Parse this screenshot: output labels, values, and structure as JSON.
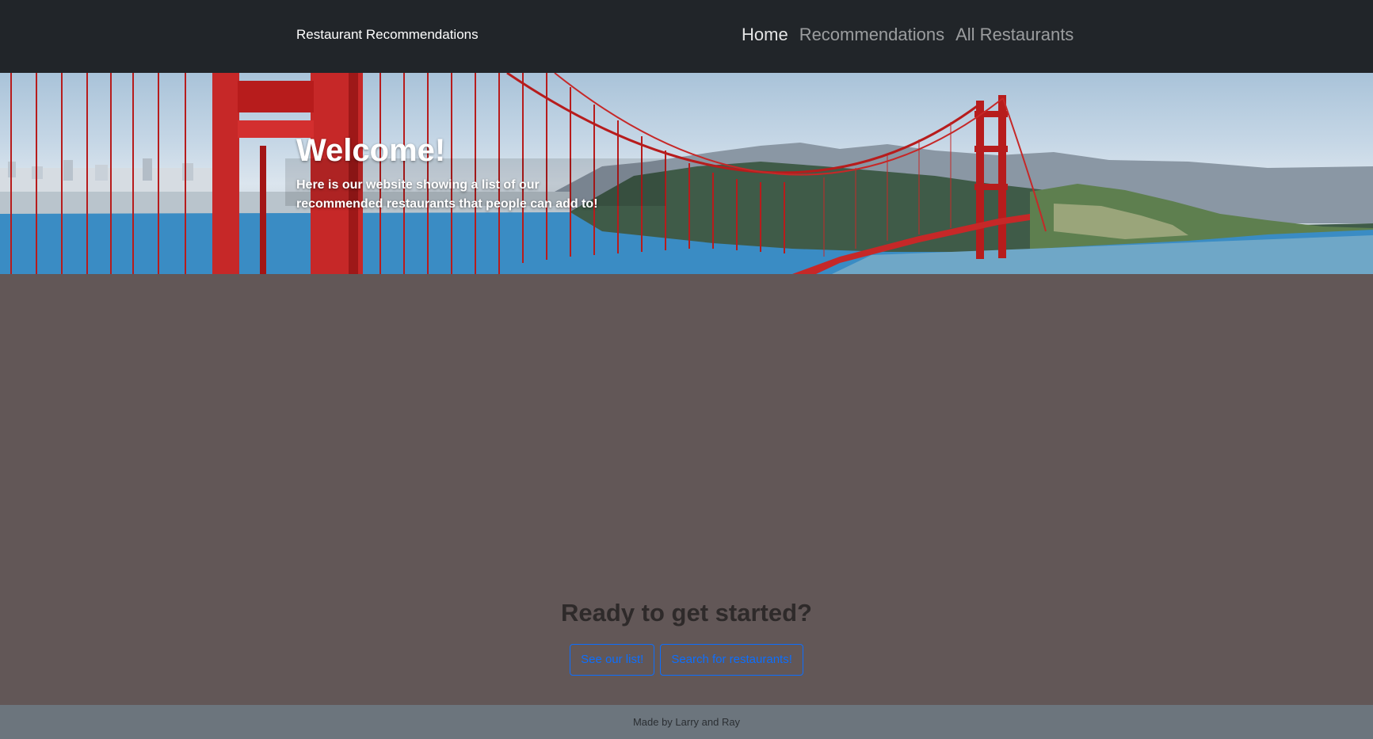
{
  "navbar": {
    "brand": "Restaurant Recommendations",
    "links": [
      {
        "label": "Home",
        "active": true
      },
      {
        "label": "Recommendations",
        "active": false
      },
      {
        "label": "All Restaurants",
        "active": false
      }
    ]
  },
  "hero": {
    "title": "Welcome!",
    "lead": "Here is our website showing a list of our recommended restaurants that people can add to!"
  },
  "cta": {
    "title": "Ready to get started?",
    "buttons": [
      {
        "label": "See our list!"
      },
      {
        "label": "Search for restaurants!"
      }
    ]
  },
  "footer": {
    "text": "Made by Larry and Ray"
  },
  "colors": {
    "navbar_bg": "#212529",
    "page_bg": "#625757",
    "footer_bg": "#6c757d",
    "button_accent": "#0d6efd",
    "bridge_red": "#c62828"
  }
}
